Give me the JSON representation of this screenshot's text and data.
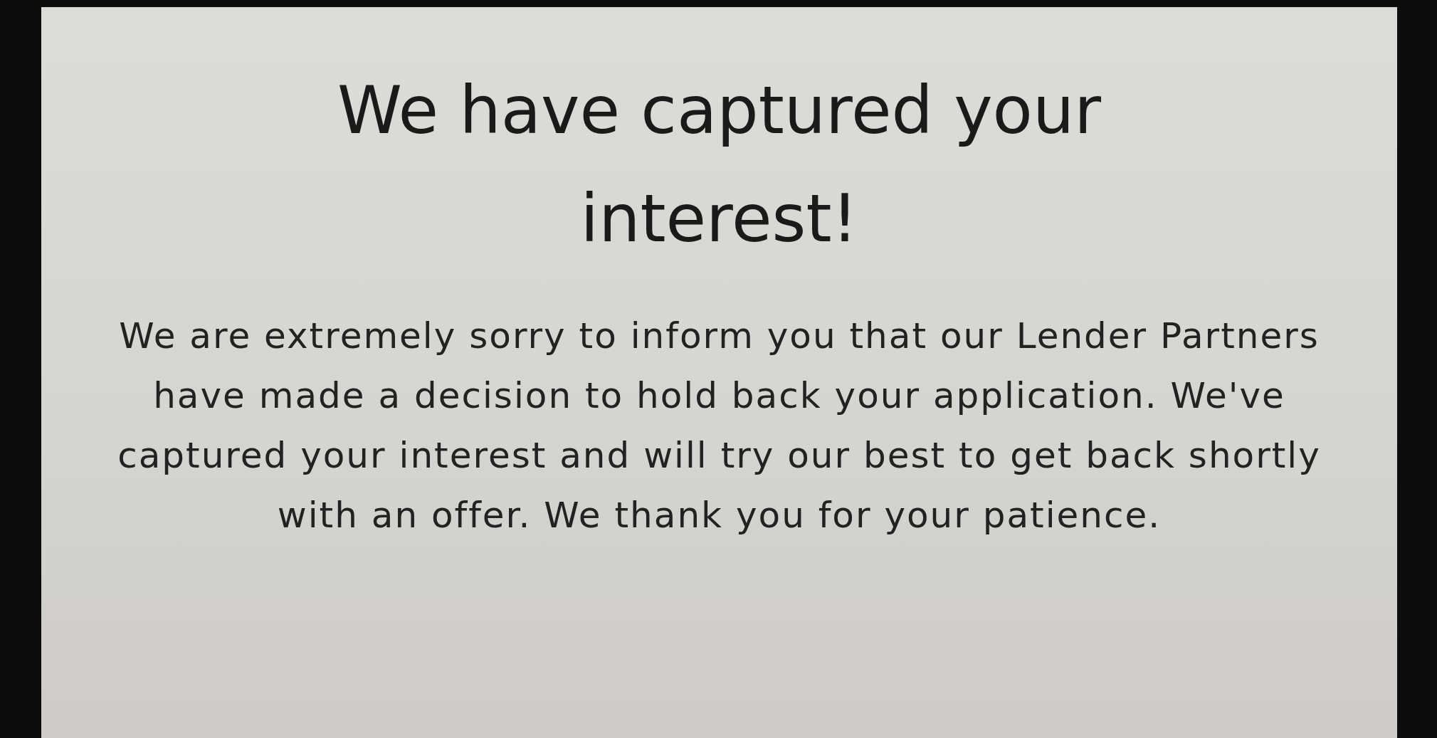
{
  "screen": {
    "title": "We have captured your interest!",
    "message": "We are extremely sorry to inform you that our Lender Partners have made a decision to hold back your application. We've captured your interest and will try our best to get back shortly with an offer. We thank you for your patience."
  }
}
